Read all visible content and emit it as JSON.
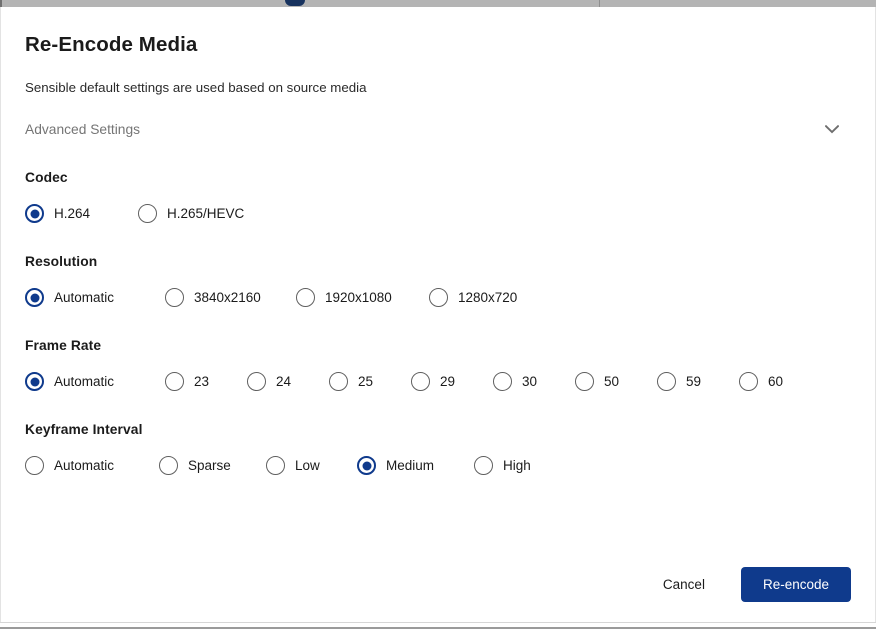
{
  "colors": {
    "accent": "#0f3a8c",
    "radio_unselected_outline": "#606060",
    "muted_text": "#757575",
    "primary_text": "#1b1b1b",
    "chrome_strip": "#b4b4b4"
  },
  "dialog": {
    "title": "Re-Encode Media",
    "subtitle": "Sensible default settings are used based on source media",
    "advanced_settings": {
      "label": "Advanced Settings",
      "icon": "chevron-down-icon",
      "expanded": false
    }
  },
  "groups": [
    {
      "key": "codec",
      "heading": "Codec",
      "selected": "H.264",
      "options": [
        {
          "label": "H.264",
          "selected": true
        },
        {
          "label": "H.265/HEVC",
          "selected": false
        }
      ]
    },
    {
      "key": "resolution",
      "heading": "Resolution",
      "selected": "Automatic",
      "options": [
        {
          "label": "Automatic",
          "selected": true
        },
        {
          "label": "3840x2160",
          "selected": false
        },
        {
          "label": "1920x1080",
          "selected": false
        },
        {
          "label": "1280x720",
          "selected": false
        }
      ]
    },
    {
      "key": "framerate",
      "heading": "Frame Rate",
      "selected": "Automatic",
      "options": [
        {
          "label": "Automatic",
          "selected": true
        },
        {
          "label": "23",
          "selected": false
        },
        {
          "label": "24",
          "selected": false
        },
        {
          "label": "25",
          "selected": false
        },
        {
          "label": "29",
          "selected": false
        },
        {
          "label": "30",
          "selected": false
        },
        {
          "label": "50",
          "selected": false
        },
        {
          "label": "59",
          "selected": false
        },
        {
          "label": "60",
          "selected": false
        }
      ]
    },
    {
      "key": "keyframe",
      "heading": "Keyframe Interval",
      "selected": "Medium",
      "options": [
        {
          "label": "Automatic",
          "selected": false
        },
        {
          "label": "Sparse",
          "selected": false
        },
        {
          "label": "Low",
          "selected": false
        },
        {
          "label": "Medium",
          "selected": true
        },
        {
          "label": "High",
          "selected": false
        }
      ]
    }
  ],
  "footer": {
    "cancel_label": "Cancel",
    "submit_label": "Re-encode"
  }
}
